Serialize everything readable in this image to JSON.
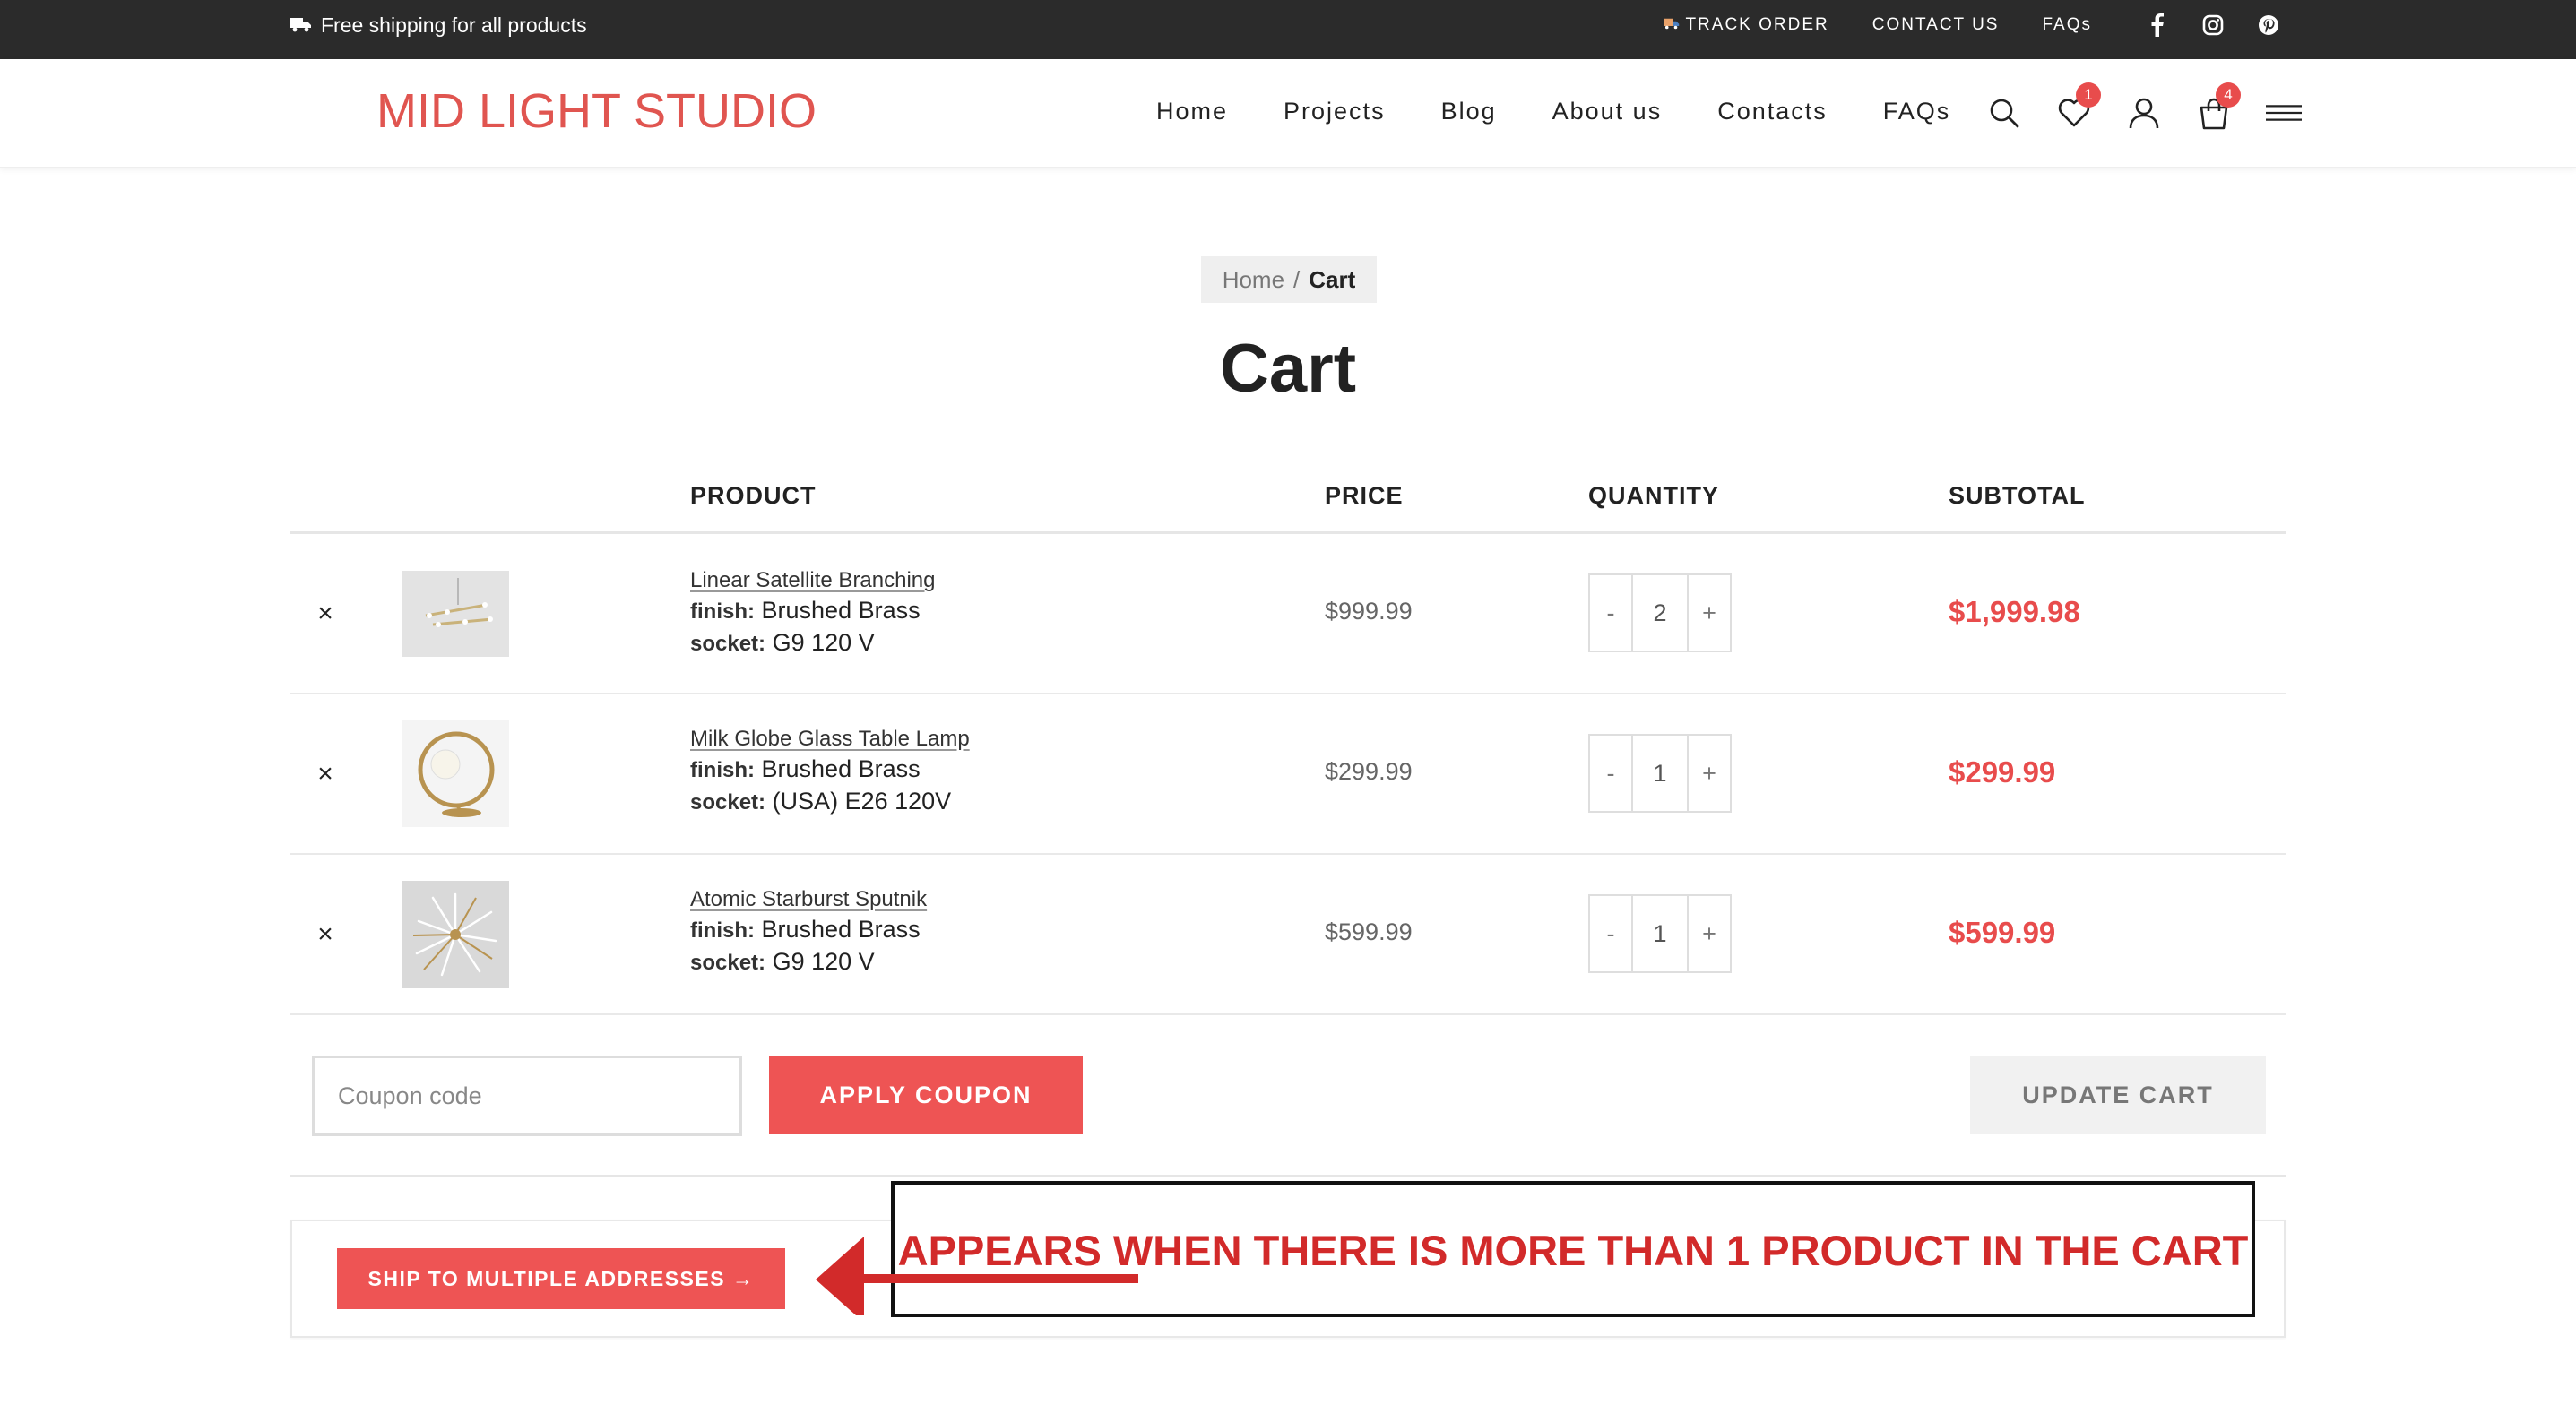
{
  "topbar": {
    "shipping_text": "Free shipping for all products",
    "track_order": "TRACK ORDER",
    "contact_us": "CONTACT US",
    "faqs": "FAQs",
    "social": [
      "facebook-icon",
      "instagram-icon",
      "pinterest-icon"
    ]
  },
  "header": {
    "logo": "MID LIGHT STUDIO",
    "nav": [
      "Home",
      "Projects",
      "Blog",
      "About us",
      "Contacts",
      "FAQs"
    ],
    "wishlist_count": "1",
    "cart_count": "4"
  },
  "breadcrumb": {
    "home": "Home",
    "sep": "/",
    "current": "Cart"
  },
  "page_title": "Cart",
  "table": {
    "headers": {
      "product": "PRODUCT",
      "price": "PRICE",
      "quantity": "QUANTITY",
      "subtotal": "SUBTOTAL"
    },
    "rows": [
      {
        "name": "Linear Satellite Branching",
        "finish_label": "finish:",
        "finish": "Brushed Brass",
        "socket_label": "socket:",
        "socket": "G9 120 V",
        "price": "$999.99",
        "qty": "2",
        "subtotal": "$1,999.98"
      },
      {
        "name": "Milk Globe Glass Table Lamp",
        "finish_label": "finish:",
        "finish": "Brushed Brass",
        "socket_label": "socket:",
        "socket": "(USA) E26 120V",
        "price": "$299.99",
        "qty": "1",
        "subtotal": "$299.99"
      },
      {
        "name": "Atomic Starburst Sputnik",
        "finish_label": "finish:",
        "finish": "Brushed Brass",
        "socket_label": "socket:",
        "socket": "G9 120 V",
        "price": "$599.99",
        "qty": "1",
        "subtotal": "$599.99"
      }
    ],
    "remove_symbol": "×",
    "minus": "-",
    "plus": "+"
  },
  "actions": {
    "coupon_placeholder": "Coupon code",
    "apply_coupon": "APPLY COUPON",
    "update_cart": "UPDATE CART"
  },
  "ship_multiple": "SHIP TO MULTIPLE ADDRESSES →",
  "annotation": "APPEARS WHEN THERE IS MORE THAN 1 PRODUCT IN THE CART",
  "colors": {
    "accent": "#ee5454",
    "topbar": "#2b2b2b",
    "annotation": "#d22a2a"
  }
}
